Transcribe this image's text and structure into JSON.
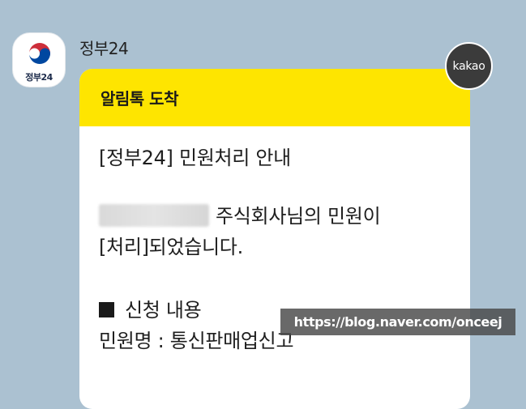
{
  "sender": {
    "name": "정부24",
    "avatar_label": "정부24"
  },
  "badge": {
    "label": "kakao"
  },
  "message": {
    "header": "알림톡 도착",
    "title_line": "[정부24] 민원처리 안내",
    "body_line_1": "주식회사님의 민원이",
    "body_line_2": "[처리]되었습니다.",
    "section_label": "신청 내용",
    "item_line": "민원명 : 통신판매업신고"
  },
  "watermark": {
    "text": "https://blog.naver.com/onceej"
  },
  "colors": {
    "background": "#abc1d1",
    "header_yellow": "#fee500",
    "logo_red": "#cd2e3a",
    "logo_blue": "#0047a0"
  },
  "icons": {
    "avatar": "taegeuk-emblem-icon",
    "section_bullet": "black-square-icon"
  }
}
